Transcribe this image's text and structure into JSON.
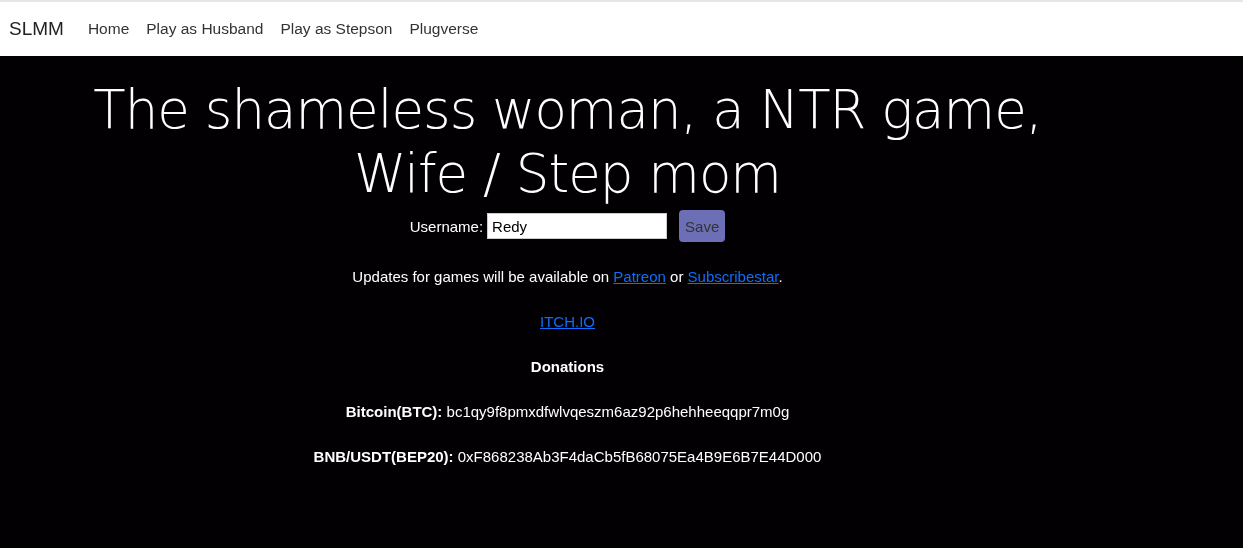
{
  "navbar": {
    "brand": "SLMM",
    "links": [
      "Home",
      "Play as Husband",
      "Play as Stepson",
      "Plugverse"
    ]
  },
  "title": "The shameless woman, a NTR game, Wife / Step mom",
  "username": {
    "label": "Username:",
    "value": "Redy",
    "button": "Save"
  },
  "updates": {
    "before": "Updates for games will be available on ",
    "links": [
      "Patreon",
      "Subscribestar"
    ],
    "between": " or ",
    "after": "."
  },
  "itch_link": "ITCH.IO",
  "donations": {
    "heading": "Donations",
    "lines": [
      "**Bitcoin(BTC):** bc1qy9f8pmxdfwlvqeszm6az92p6hehheeqqpr7m0g",
      "**BNB/USDT(BEP20):** 0xF868238Ab3F4daCb5fB68075Ea4B9E6B7E44D000"
    ]
  }
}
